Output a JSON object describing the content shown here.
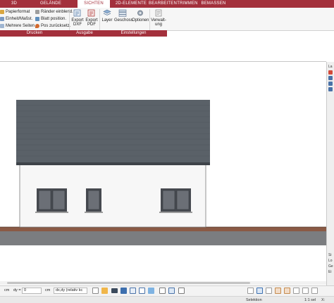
{
  "tabs": [
    "3D",
    "GELÄNDE",
    "SICHTEN",
    "2D-ELEMENTE",
    "BEARBEITEN",
    "TRIMMEN",
    "BEMASSEN"
  ],
  "active_tab": "SICHTEN",
  "ribbon": {
    "druck_items": [
      "Papierformat",
      "Einheit/Maßst.",
      "Mehrere Seiten"
    ],
    "ausgabe_items": [
      "Ränder einblend.",
      "Blatt position.",
      "Pos zurücksetz."
    ],
    "export_dxf": [
      "Export",
      "DXF"
    ],
    "export_pdf": [
      "Export",
      "PDF"
    ],
    "layer": "Layer",
    "geschoss": "Geschoss",
    "optionen": "Optionen",
    "verwaltung": [
      "Verwalt-",
      "ung"
    ]
  },
  "groups": {
    "drucken": "Drucken",
    "ausgabe": "Ausgabe",
    "einstellungen": "Einstellungen"
  },
  "right_panel": {
    "top_label": "La",
    "bottom_labels": [
      "Si",
      "Lo",
      "Ge",
      "Ei"
    ]
  },
  "bottom_toolbar": {
    "unit1": "cm",
    "dy_label": "dy =",
    "dy_value": "0",
    "unit2": "cm",
    "mode_select": "dx,dy (relativ kc"
  },
  "status": {
    "mode": "Selektion",
    "scale": "1:1 sel",
    "extra": "X:"
  },
  "colors": {
    "accent": "#a3303c",
    "roof": "#5a6168",
    "wall": "#f7f7f7",
    "ground": "#8a5a45",
    "window_frame": "#474a50"
  }
}
